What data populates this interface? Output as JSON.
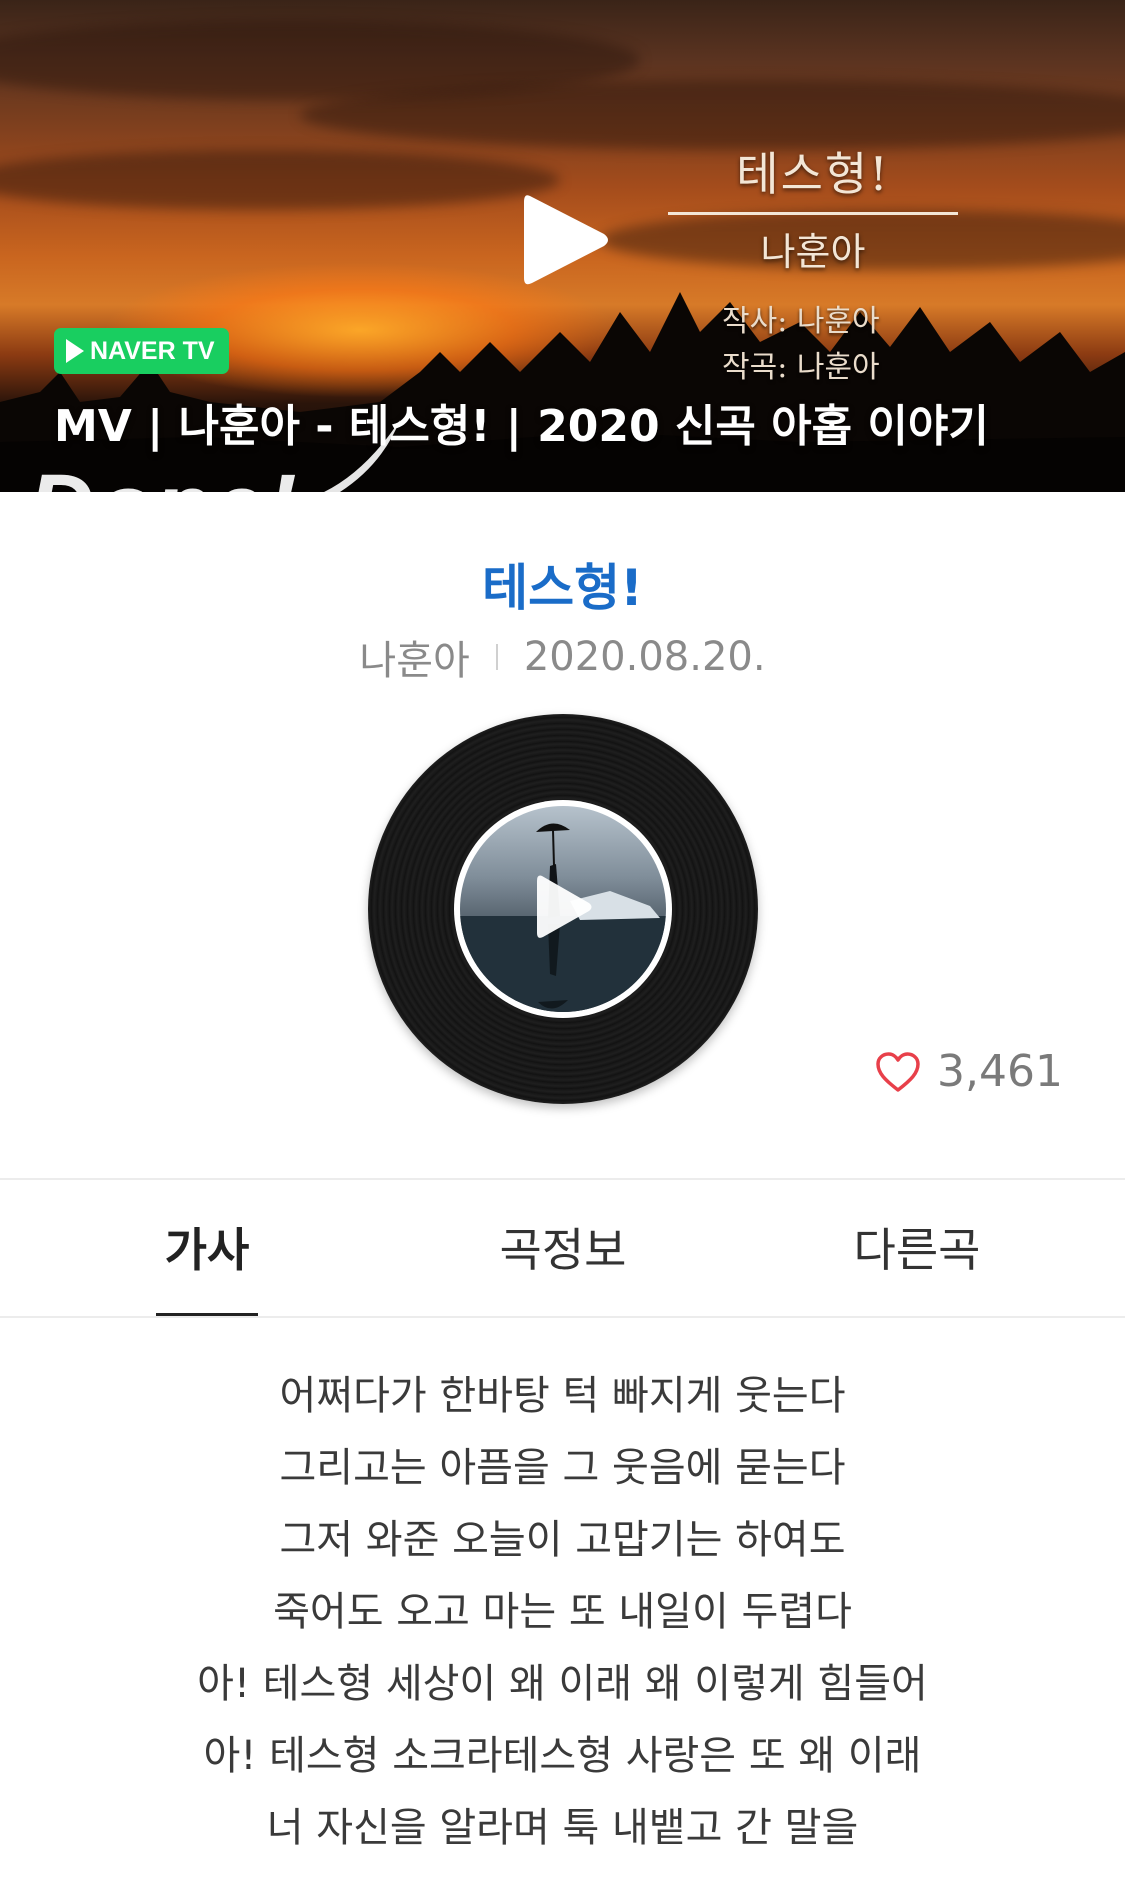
{
  "video": {
    "mv_song_title": "테스형!",
    "mv_artist": "나훈아",
    "mv_lyricist": "작사: 나훈아",
    "mv_composer": "작곡: 나훈아",
    "badge_label": "NAVER TV",
    "caption": "MV | 나훈아 - 테스형! | 2020 신곡 아홉 이야기",
    "watermark": "Dope!"
  },
  "song": {
    "title": "테스형!",
    "artist": "나훈아",
    "date": "2020.08.20."
  },
  "likes": {
    "count": "3,461"
  },
  "tabs": [
    {
      "label": "가사",
      "active": true
    },
    {
      "label": "곡정보",
      "active": false
    },
    {
      "label": "다른곡",
      "active": false
    }
  ],
  "lyrics": [
    "어쩌다가 한바탕 턱 빠지게 웃는다",
    "그리고는 아픔을 그 웃음에 묻는다",
    "그저 와준 오늘이 고맙기는 하여도",
    "죽어도 오고 마는 또 내일이 두렵다",
    "아! 테스형 세상이 왜 이래 왜 이렇게 힘들어",
    "아! 테스형 소크라테스형 사랑은 또 왜 이래",
    "너 자신을 알라며 툭 내뱉고 간 말을"
  ],
  "colors": {
    "title_blue": "#1a6cc8",
    "naver_green": "#19ce60",
    "heart": "#e8404a"
  }
}
